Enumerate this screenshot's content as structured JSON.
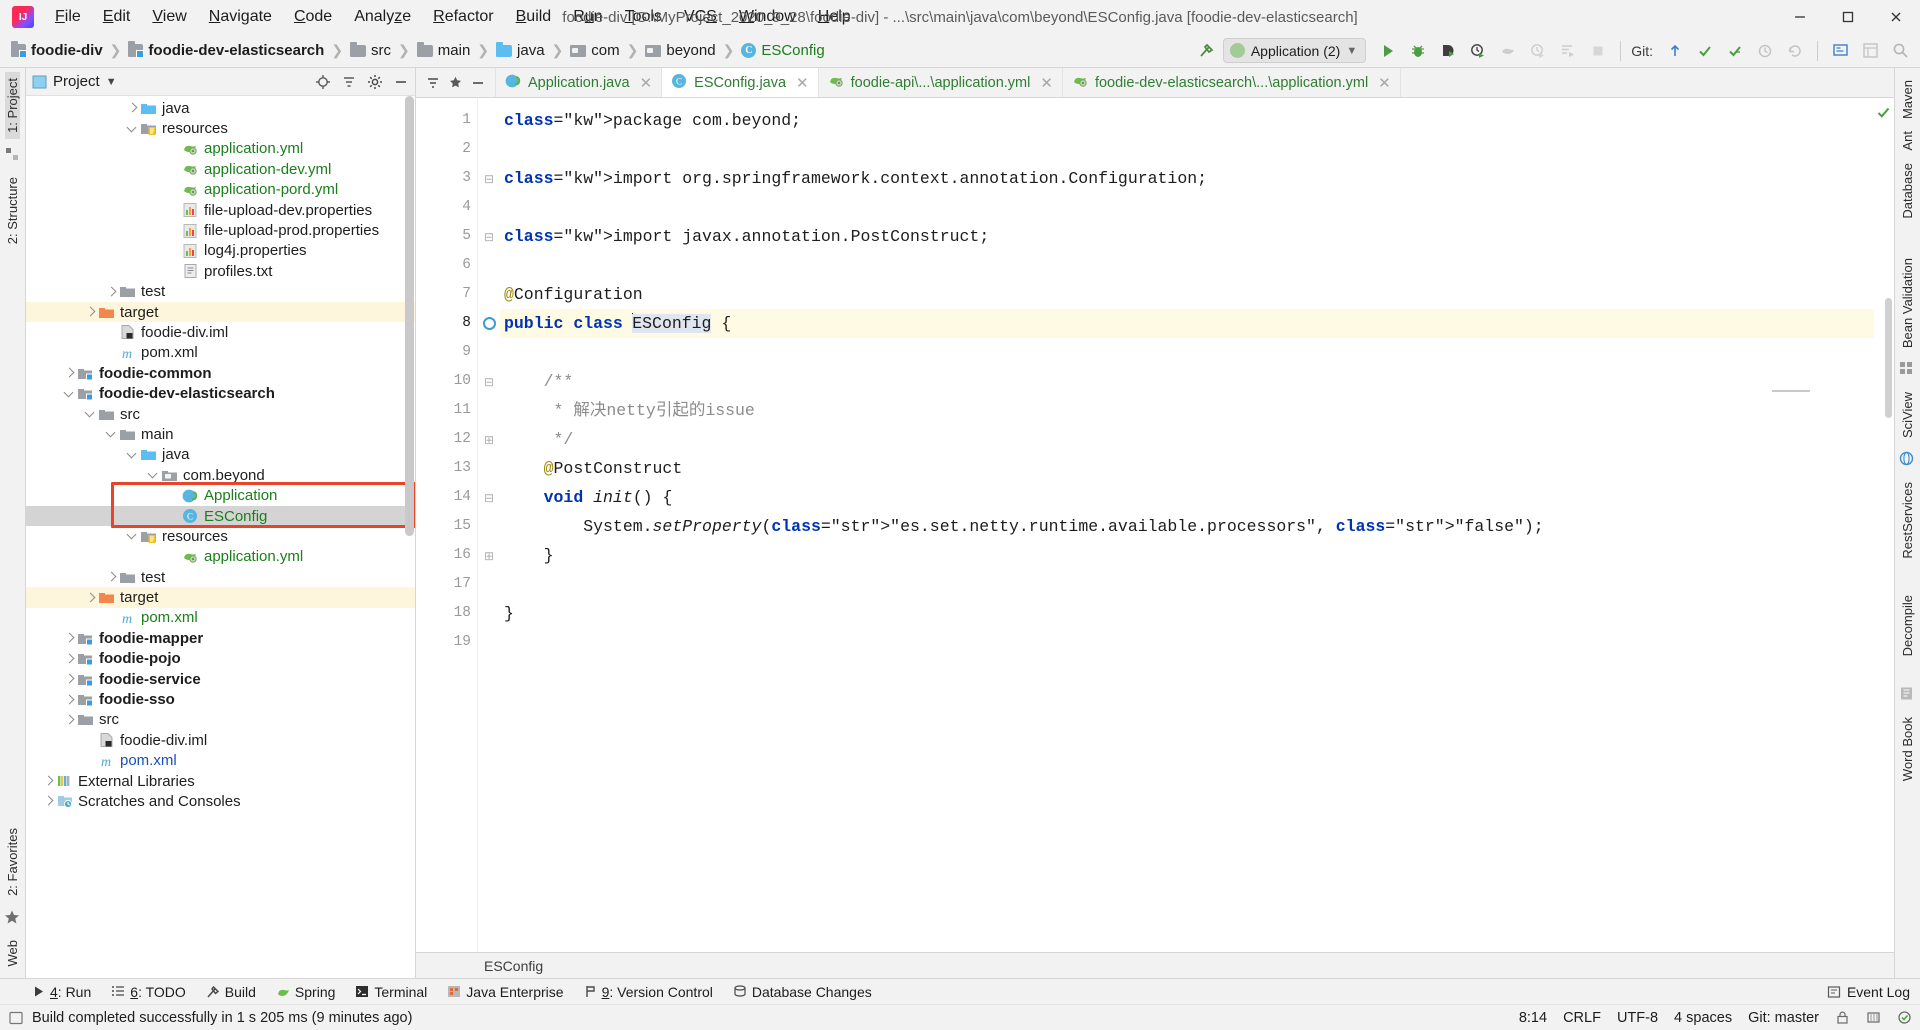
{
  "window": {
    "title": "foodie-div [G:\\MyProject_2020_9_28\\foodie-div] - ...\\src\\main\\java\\com\\beyond\\ESConfig.java [foodie-dev-elasticsearch]",
    "minimize_label": "—",
    "maximize_label": "❐",
    "close_label": "✕"
  },
  "menu": [
    {
      "label": "File"
    },
    {
      "label": "Edit"
    },
    {
      "label": "View"
    },
    {
      "label": "Navigate"
    },
    {
      "label": "Code"
    },
    {
      "label": "Analyze"
    },
    {
      "label": "Refactor"
    },
    {
      "label": "Build"
    },
    {
      "label": "Run"
    },
    {
      "label": "Tools"
    },
    {
      "label": "VCS"
    },
    {
      "label": "Window"
    },
    {
      "label": "Help"
    }
  ],
  "breadcrumbs": [
    {
      "label": "foodie-div",
      "icon": "module-icon",
      "style": "bold"
    },
    {
      "label": "foodie-dev-elasticsearch",
      "icon": "module-icon",
      "style": "bold"
    },
    {
      "label": "src",
      "icon": "folder-icon",
      "style": "normal"
    },
    {
      "label": "main",
      "icon": "folder-icon",
      "style": "normal"
    },
    {
      "label": "java",
      "icon": "source-folder-icon",
      "style": "normal"
    },
    {
      "label": "com",
      "icon": "package-icon",
      "style": "normal"
    },
    {
      "label": "beyond",
      "icon": "package-icon",
      "style": "normal"
    },
    {
      "label": "ESConfig",
      "icon": "class-icon",
      "style": "green"
    }
  ],
  "toolbar": {
    "run_config": "Application (2)",
    "run_config_chevron": "∨",
    "git_label": "Git:",
    "buttons": [
      {
        "name": "build-hammer-icon",
        "label": "Build"
      },
      {
        "name": "run-icon",
        "label": "Run"
      },
      {
        "name": "debug-icon",
        "label": "Debug"
      },
      {
        "name": "run-coverage-icon",
        "label": "Run with Coverage"
      },
      {
        "name": "profile-icon",
        "label": "Profile"
      },
      {
        "name": "attach-icon",
        "label": "Attach"
      },
      {
        "name": "rerun-icon",
        "label": "Rerun"
      },
      {
        "name": "show-running-icon",
        "label": "Show Running"
      },
      {
        "name": "stop-icon",
        "label": "Stop"
      },
      {
        "name": "git-update-icon",
        "label": "Update Project"
      },
      {
        "name": "git-commit-icon",
        "label": "Commit"
      },
      {
        "name": "git-push-icon",
        "label": "Push"
      },
      {
        "name": "git-history-icon",
        "label": "History"
      },
      {
        "name": "git-revert-icon",
        "label": "Revert"
      },
      {
        "name": "search-everywhere-icon",
        "label": "Search Everywhere"
      },
      {
        "name": "settings-icon",
        "label": "Settings"
      },
      {
        "name": "project-structure-icon",
        "label": "Project Structure"
      },
      {
        "name": "search-icon",
        "label": "Search"
      }
    ]
  },
  "project_panel": {
    "title": "Project",
    "title_chevron": "▾",
    "header_icons": [
      "locate-icon",
      "collapse-all-icon",
      "settings-icon",
      "hide-icon"
    ],
    "tree": [
      {
        "indent": 3,
        "chev": "right",
        "icon": "source-folder-icon",
        "label": "java"
      },
      {
        "indent": 3,
        "chev": "down",
        "icon": "resource-folder-icon",
        "label": "resources"
      },
      {
        "indent": 5,
        "chev": "none",
        "icon": "yml-icon",
        "label": "application.yml",
        "color": "green"
      },
      {
        "indent": 5,
        "chev": "none",
        "icon": "yml-icon",
        "label": "application-dev.yml",
        "color": "green"
      },
      {
        "indent": 5,
        "chev": "none",
        "icon": "yml-icon",
        "label": "application-pord.yml",
        "color": "green"
      },
      {
        "indent": 5,
        "chev": "none",
        "icon": "properties-icon",
        "label": "file-upload-dev.properties"
      },
      {
        "indent": 5,
        "chev": "none",
        "icon": "properties-icon",
        "label": "file-upload-prod.properties"
      },
      {
        "indent": 5,
        "chev": "none",
        "icon": "properties-icon",
        "label": "log4j.properties"
      },
      {
        "indent": 5,
        "chev": "none",
        "icon": "text-file-icon",
        "label": "profiles.txt"
      },
      {
        "indent": 2,
        "chev": "right",
        "icon": "folder-icon",
        "label": "test"
      },
      {
        "indent": 1,
        "chev": "right",
        "icon": "target-folder-icon",
        "label": "target",
        "row": "highlight"
      },
      {
        "indent": 2,
        "chev": "none",
        "icon": "iml-icon",
        "label": "foodie-div.iml"
      },
      {
        "indent": 2,
        "chev": "none",
        "icon": "maven-icon",
        "label": "pom.xml"
      },
      {
        "indent": 0,
        "chev": "right",
        "icon": "module-icon",
        "label": "foodie-common",
        "bold": true
      },
      {
        "indent": 0,
        "chev": "down",
        "icon": "module-icon",
        "label": "foodie-dev-elasticsearch",
        "bold": true
      },
      {
        "indent": 1,
        "chev": "down",
        "icon": "folder-icon",
        "label": "src"
      },
      {
        "indent": 2,
        "chev": "down",
        "icon": "folder-icon",
        "label": "main"
      },
      {
        "indent": 3,
        "chev": "down",
        "icon": "source-folder-icon",
        "label": "java"
      },
      {
        "indent": 4,
        "chev": "down",
        "icon": "package-icon",
        "label": "com.beyond"
      },
      {
        "indent": 5,
        "chev": "none",
        "icon": "spring-class-icon",
        "label": "Application",
        "color": "green"
      },
      {
        "indent": 5,
        "chev": "none",
        "icon": "class-icon",
        "label": "ESConfig",
        "color": "green",
        "row": "selected"
      },
      {
        "indent": 3,
        "chev": "down",
        "icon": "resource-folder-icon",
        "label": "resources"
      },
      {
        "indent": 5,
        "chev": "none",
        "icon": "yml-icon",
        "label": "application.yml",
        "color": "green"
      },
      {
        "indent": 2,
        "chev": "right",
        "icon": "folder-icon",
        "label": "test"
      },
      {
        "indent": 1,
        "chev": "right",
        "icon": "target-folder-icon",
        "label": "target",
        "row": "highlight"
      },
      {
        "indent": 2,
        "chev": "none",
        "icon": "maven-icon",
        "label": "pom.xml",
        "color": "green"
      },
      {
        "indent": 0,
        "chev": "right",
        "icon": "module-icon",
        "label": "foodie-mapper",
        "bold": true
      },
      {
        "indent": 0,
        "chev": "right",
        "icon": "module-icon",
        "label": "foodie-pojo",
        "bold": true
      },
      {
        "indent": 0,
        "chev": "right",
        "icon": "module-icon",
        "label": "foodie-service",
        "bold": true
      },
      {
        "indent": 0,
        "chev": "right",
        "icon": "module-icon",
        "label": "foodie-sso",
        "bold": true
      },
      {
        "indent": 0,
        "chev": "right",
        "icon": "folder-icon",
        "label": "src"
      },
      {
        "indent": 1,
        "chev": "none",
        "icon": "iml-icon",
        "label": "foodie-div.iml"
      },
      {
        "indent": 1,
        "chev": "none",
        "icon": "maven-icon",
        "label": "pom.xml",
        "color": "blue"
      },
      {
        "indent": -1,
        "chev": "right",
        "icon": "libraries-icon",
        "label": "External Libraries"
      },
      {
        "indent": -1,
        "chev": "right",
        "icon": "scratches-icon",
        "label": "Scratches and Consoles"
      }
    ]
  },
  "left_rail": {
    "items": [
      {
        "label": "1: Project",
        "name": "rail-project",
        "selected": true
      },
      {
        "label": "2: Structure",
        "name": "rail-structure",
        "selected": false
      },
      {
        "label": "2: Favorites",
        "name": "rail-favorites",
        "selected": false
      },
      {
        "label": "Web",
        "name": "rail-web",
        "selected": false
      }
    ]
  },
  "right_rail": {
    "items": [
      {
        "label": "Maven",
        "name": "rail-maven"
      },
      {
        "label": "Ant",
        "name": "rail-ant"
      },
      {
        "label": "Database",
        "name": "rail-database"
      },
      {
        "label": "Bean Validation",
        "name": "rail-bean-validation"
      },
      {
        "label": "SciView",
        "name": "rail-sciview"
      },
      {
        "label": "RestServices",
        "name": "rail-restservices"
      },
      {
        "label": "Decompile",
        "name": "rail-decompile"
      },
      {
        "label": "Word Book",
        "name": "rail-word-book"
      }
    ]
  },
  "editor": {
    "tabs": [
      {
        "label": "Application.java",
        "icon": "spring-class-icon",
        "color": "green",
        "active": false
      },
      {
        "label": "ESConfig.java",
        "icon": "class-icon",
        "color": "green",
        "active": true
      },
      {
        "label": "foodie-api\\...\\application.yml",
        "icon": "yml-icon",
        "color": "green",
        "active": false
      },
      {
        "label": "foodie-dev-elasticsearch\\...\\application.yml",
        "icon": "yml-icon",
        "color": "green",
        "active": false
      }
    ],
    "close_glyph": "✕",
    "line_numbers": [
      "1",
      "2",
      "3",
      "4",
      "5",
      "6",
      "7",
      "8",
      "9",
      "10",
      "11",
      "12",
      "13",
      "14",
      "15",
      "16",
      "17",
      "18",
      "19"
    ],
    "current_line": 8,
    "lines": [
      "package com.beyond;",
      "",
      "import org.springframework.context.annotation.Configuration;",
      "",
      "import javax.annotation.PostConstruct;",
      "",
      "@Configuration",
      "public class ESConfig {",
      "",
      "    /**",
      "     * 解决netty引起的issue",
      "     */",
      "    @PostConstruct",
      "    void init() {",
      "        System.setProperty(\"es.set.netty.runtime.available.processors\", \"false\");",
      "    }",
      "",
      "}",
      ""
    ],
    "breadcrumb_bottom": "ESConfig"
  },
  "bottom_tool_window": {
    "items": [
      {
        "label": "4: Run",
        "accel": "4",
        "icon": "run-icon"
      },
      {
        "label": "6: TODO",
        "accel": "6",
        "icon": "todo-icon"
      },
      {
        "label": "Build",
        "accel": "",
        "icon": "build-icon"
      },
      {
        "label": "Spring",
        "accel": "",
        "icon": "spring-icon"
      },
      {
        "label": "Terminal",
        "accel": "",
        "icon": "terminal-icon"
      },
      {
        "label": "Java Enterprise",
        "accel": "",
        "icon": "java-enterprise-icon"
      },
      {
        "label": "9: Version Control",
        "accel": "9",
        "icon": "version-control-icon"
      },
      {
        "label": "Database Changes",
        "accel": "",
        "icon": "database-changes-icon"
      }
    ],
    "event_log": "Event Log"
  },
  "statusbar": {
    "message": "Build completed successfully in 1 s 205 ms (9 minutes ago)",
    "caret_position": "8:14",
    "line_separator": "CRLF",
    "encoding": "UTF-8",
    "indent": "4 spaces",
    "git_branch": "Git: master",
    "icons": [
      "lock-icon",
      "memory-icon",
      "inspection-icon"
    ]
  },
  "colors": {
    "accent_green": "#4b8c3f",
    "string_green": "#067d17",
    "keyword_blue": "#0033b3",
    "annotation_yellow": "#9e880d",
    "highlight_row": "#fdf6dc",
    "selection_gray": "#d4d4d4",
    "redbox": "#e8442a"
  }
}
